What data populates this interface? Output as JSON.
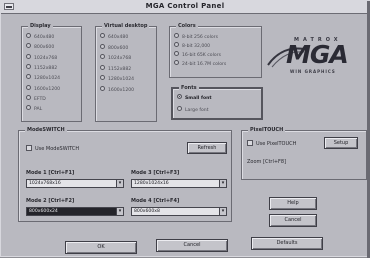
{
  "window": {
    "title": "MGA Control Panel"
  },
  "display": {
    "label": "Display",
    "options": [
      "640x480",
      "800x600",
      "1024x768",
      "1152x882",
      "1280x1024",
      "1600x1200",
      "EFTD",
      "PAL"
    ],
    "selected_index": -1
  },
  "virtual_desktop": {
    "label": "Virtual desktop",
    "options": [
      "640x480",
      "800x600",
      "1024x768",
      "1152x882",
      "1280x1024",
      "1600x1200"
    ],
    "selected_index": -1
  },
  "colors": {
    "label": "Colors",
    "options": [
      "8-bit 256 colors",
      "8-bit 32,000",
      "16-bit 65K colors",
      "24-bit 16.7M colors"
    ],
    "selected_index": -1
  },
  "logo": {
    "top": "MATROX",
    "main": "MGA",
    "bottom": "WIN GRAPHICS"
  },
  "fonts": {
    "label": "Fonts",
    "options": [
      "Small font",
      "Large font"
    ],
    "selected_index": 0
  },
  "modeswitch": {
    "label": "ModeSWITCH",
    "use_label": "Use ModeSWITCH",
    "use_checked": false,
    "refresh_label": "Refresh",
    "modes": [
      {
        "label": "Mode 1 [Ctrl+F1]",
        "value": "1024x768x16",
        "highlighted": false
      },
      {
        "label": "Mode 3 [Ctrl+F3]",
        "value": "1280x1024x16",
        "highlighted": false
      },
      {
        "label": "Mode 2 [Ctrl+F2]",
        "value": "800x600x24",
        "highlighted": true
      },
      {
        "label": "Mode 4 [Ctrl+F4]",
        "value": "800x600x8",
        "highlighted": false
      }
    ]
  },
  "pixeltouch": {
    "label": "PixelTOUCH",
    "use_label": "Use PixelTOUCH",
    "use_checked": false,
    "setup_label": "Setup",
    "zoom_label": "Zoom [Ctrl+F8]"
  },
  "buttons": {
    "help": "Help",
    "cancel_side": "Cancel",
    "ok": "OK",
    "cancel": "Cancel",
    "defaults": "Defaults"
  },
  "colors_theme": {
    "face": "#b9b9c0",
    "shadow": "#6b6b73",
    "highlight": "#dcdce2",
    "text": "#2a2a30"
  }
}
